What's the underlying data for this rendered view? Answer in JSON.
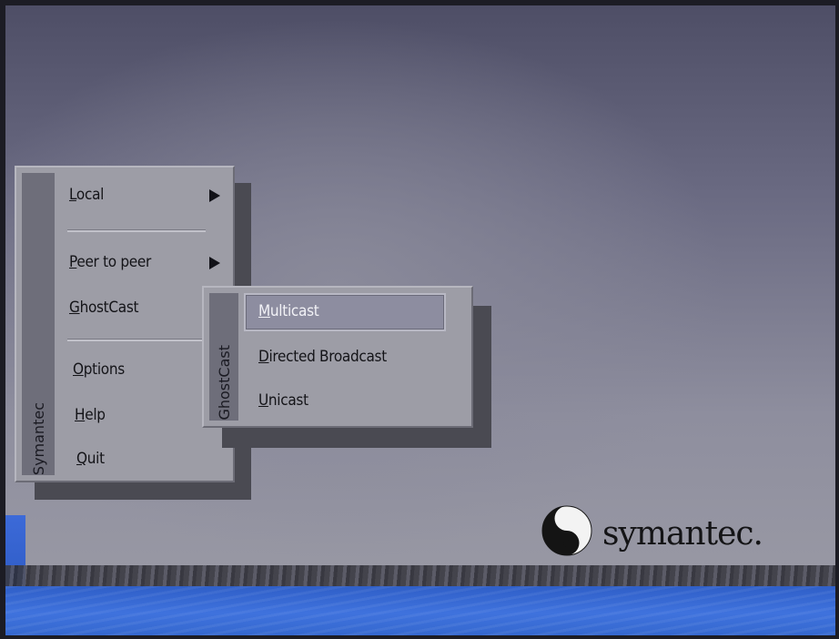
{
  "main_menu": {
    "vendor_label": "Symantec",
    "items": [
      {
        "label": "Local",
        "accel": "L",
        "rest": "ocal",
        "submenu": true
      },
      {
        "label": "Peer to peer",
        "accel": "P",
        "rest": "eer to peer",
        "submenu": true
      },
      {
        "label": "GhostCast",
        "accel": "G",
        "rest": "hostCast",
        "submenu": true
      },
      {
        "label": "Options",
        "accel": "O",
        "rest": "ptions",
        "submenu": false
      },
      {
        "label": "Help",
        "accel": "H",
        "rest": "elp",
        "submenu": false
      },
      {
        "label": "Quit",
        "accel": "Q",
        "rest": "uit",
        "submenu": false
      }
    ]
  },
  "ghostcast_menu": {
    "side_label": "GhostCast",
    "items": [
      {
        "label": "Multicast",
        "accel": "M",
        "rest": "ulticast",
        "selected": true
      },
      {
        "label": "Directed Broadcast",
        "accel": "D",
        "rest": "irected Broadcast",
        "selected": false
      },
      {
        "label": "Unicast",
        "accel": "U",
        "rest": "nicast",
        "selected": false
      }
    ]
  },
  "branding": {
    "logo_text": "symantec.",
    "logo_icon": "symantec-logo-icon"
  },
  "colors": {
    "menu_bg": "#9d9da6",
    "side_bar": "#6e6e7a",
    "desktop_blue": "#3f72dd"
  }
}
